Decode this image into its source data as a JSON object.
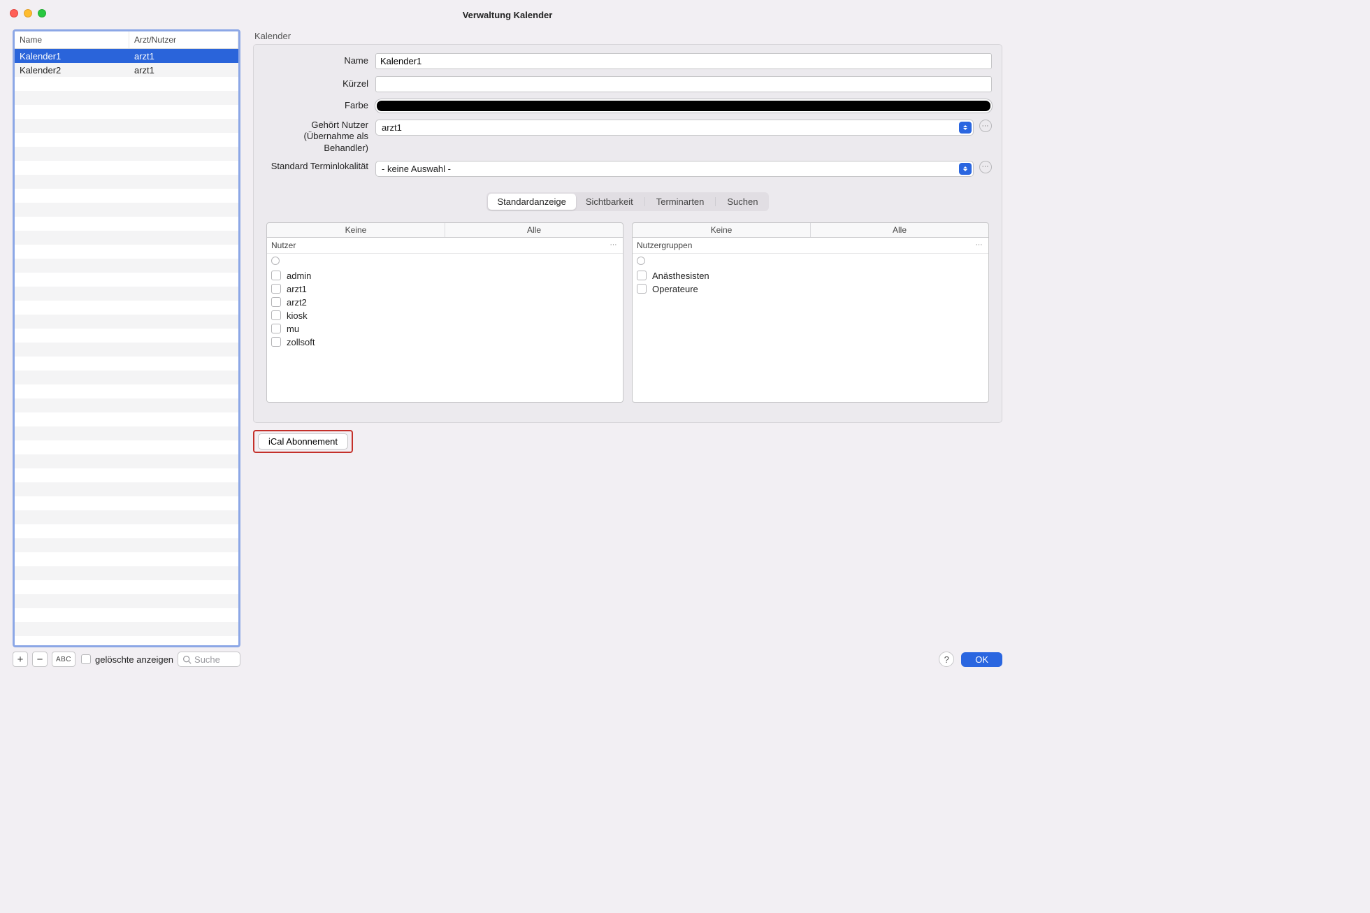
{
  "window": {
    "title": "Verwaltung Kalender"
  },
  "list": {
    "headers": {
      "name": "Name",
      "user": "Arzt/Nutzer"
    },
    "rows": [
      {
        "name": "Kalender1",
        "user": "arzt1",
        "selected": true
      },
      {
        "name": "Kalender2",
        "user": "arzt1",
        "selected": false
      }
    ]
  },
  "toolbar": {
    "add": "+",
    "remove": "−",
    "abc": "ABC",
    "show_deleted": "gelöschte anzeigen",
    "search_placeholder": "Suche"
  },
  "details": {
    "group": "Kalender",
    "labels": {
      "name": "Name",
      "short": "Kürzel",
      "color": "Farbe",
      "owner": "Gehört Nutzer (Übernahme als Behandler)",
      "locality": "Standard Terminlokalität"
    },
    "values": {
      "name": "Kalender1",
      "short": "",
      "owner": "arzt1",
      "locality": "- keine Auswahl -",
      "color": "#000000"
    }
  },
  "tabs": {
    "t1": "Standardanzeige",
    "t2": "Sichtbarkeit",
    "t3": "Terminarten",
    "t4": "Suchen"
  },
  "dual": {
    "none": "Keine",
    "all": "Alle",
    "left_title": "Nutzer",
    "right_title": "Nutzergruppen",
    "users": [
      {
        "label": "admin"
      },
      {
        "label": "arzt1"
      },
      {
        "label": "arzt2"
      },
      {
        "label": "kiosk"
      },
      {
        "label": "mu"
      },
      {
        "label": "zollsoft"
      }
    ],
    "groups": [
      {
        "label": "Anästhesisten"
      },
      {
        "label": "Operateure"
      }
    ]
  },
  "ical": "iCal Abonnement",
  "footer": {
    "help": "?",
    "ok": "OK"
  }
}
